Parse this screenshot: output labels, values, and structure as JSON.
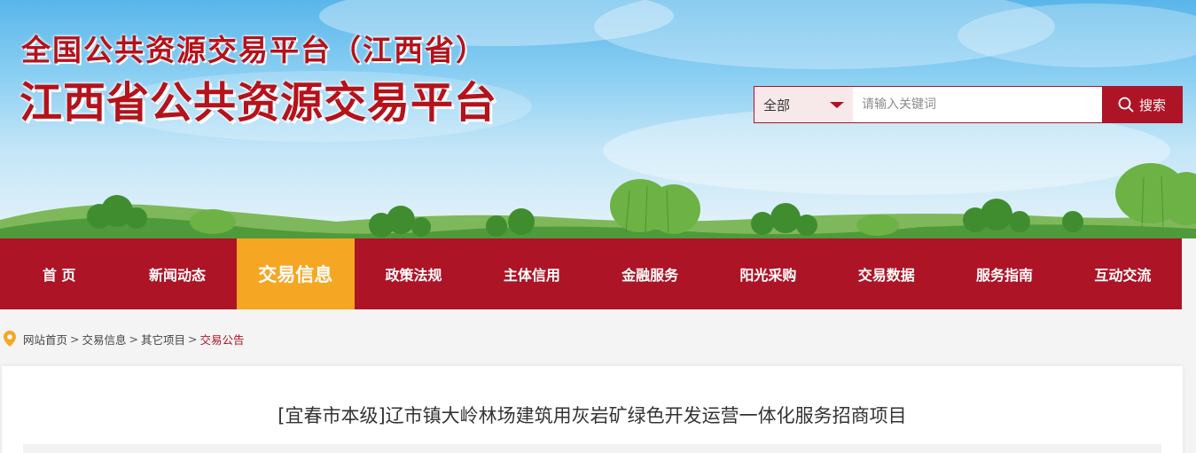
{
  "header": {
    "title_line1": "全国公共资源交易平台（江西省）",
    "title_line2": "江西省公共资源交易平台"
  },
  "search": {
    "scope_selected": "全部",
    "placeholder": "请输入关键词",
    "button_label": "搜索"
  },
  "nav": {
    "items": [
      {
        "label": "首 页"
      },
      {
        "label": "新闻动态"
      },
      {
        "label": "交易信息"
      },
      {
        "label": "政策法规"
      },
      {
        "label": "主体信用"
      },
      {
        "label": "金融服务"
      },
      {
        "label": "阳光采购"
      },
      {
        "label": "交易数据"
      },
      {
        "label": "服务指南"
      },
      {
        "label": "互动交流"
      }
    ],
    "active_index": 2
  },
  "breadcrumb": {
    "items": [
      "网站首页",
      "交易信息",
      "其它项目"
    ],
    "separator": ">",
    "current": "交易公告"
  },
  "article": {
    "title": "[宜春市本级]辽市镇大岭林场建筑用灰岩矿绿色开发运营一体化服务招商项目"
  },
  "colors": {
    "brand_red": "#ad1426",
    "active_orange": "#f5a623",
    "title_red": "#b5121b",
    "location_pin": "#f5a623"
  },
  "icons": {
    "search": "search-icon",
    "dropdown": "caret-down-icon",
    "location": "location-pin-icon"
  }
}
